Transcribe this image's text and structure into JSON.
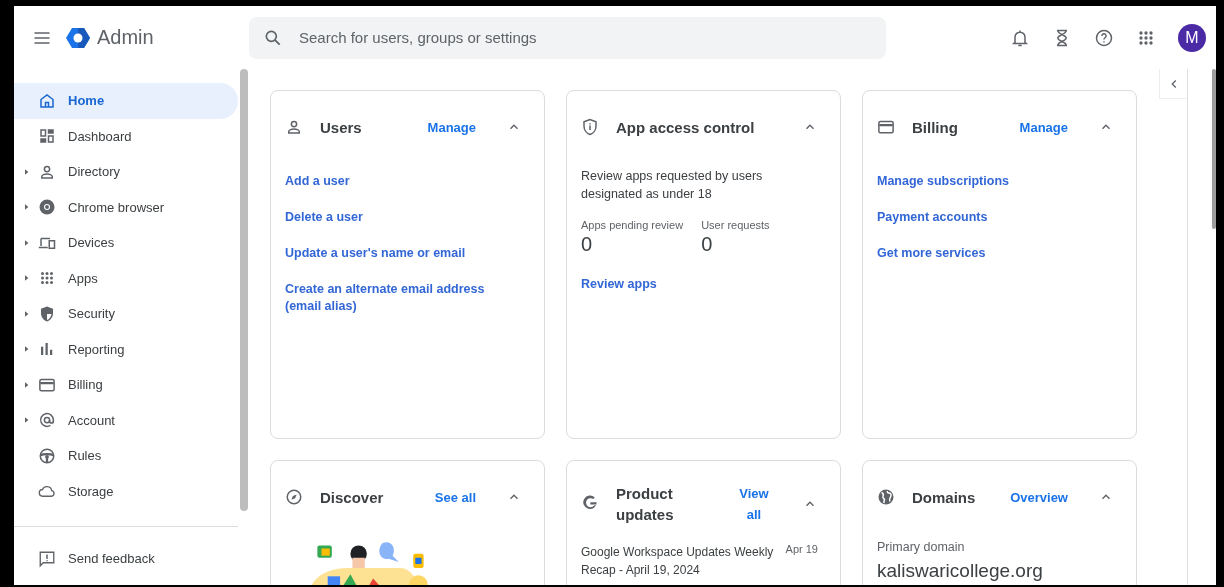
{
  "header": {
    "product": "Admin",
    "search": {
      "placeholder": "Search for users, groups or settings"
    },
    "avatar": "M"
  },
  "sidebar": {
    "items": [
      {
        "label": "Home",
        "kind": "plain",
        "selected": true
      },
      {
        "label": "Dashboard",
        "kind": "plain",
        "selected": false
      },
      {
        "label": "Directory",
        "kind": "expandable",
        "selected": false
      },
      {
        "label": "Chrome browser",
        "kind": "expandable",
        "selected": false
      },
      {
        "label": "Devices",
        "kind": "expandable",
        "selected": false
      },
      {
        "label": "Apps",
        "kind": "expandable",
        "selected": false
      },
      {
        "label": "Security",
        "kind": "expandable",
        "selected": false
      },
      {
        "label": "Reporting",
        "kind": "expandable",
        "selected": false
      },
      {
        "label": "Billing",
        "kind": "expandable",
        "selected": false
      },
      {
        "label": "Account",
        "kind": "expandable",
        "selected": false
      },
      {
        "label": "Rules",
        "kind": "plain",
        "selected": false
      },
      {
        "label": "Storage",
        "kind": "plain",
        "selected": false
      }
    ],
    "footer": "Send feedback"
  },
  "cards": [
    {
      "kind": "links",
      "title": "Users",
      "action": "Manage",
      "expanded": true,
      "links": [
        "Add a user",
        "Delete a user",
        "Update a user's name or email",
        "Create an alternate email address (email alias)"
      ]
    },
    {
      "kind": "access",
      "title": "App access control",
      "expanded": true,
      "description": "Review apps requested by users designated as under 18",
      "stats": [
        {
          "label": "Apps pending review",
          "value": "0"
        },
        {
          "label": "User requests",
          "value": "0"
        }
      ],
      "link": "Review apps"
    },
    {
      "kind": "links",
      "title": "Billing",
      "action": "Manage",
      "expanded": true,
      "links": [
        "Manage subscriptions",
        "Payment accounts",
        "Get more services"
      ]
    },
    {
      "kind": "discover",
      "title": "Discover",
      "action": "See all",
      "expanded": true
    },
    {
      "kind": "updates",
      "title": "Product updates",
      "action": "View all",
      "expanded": true,
      "items": [
        {
          "text": "Google Workspace Updates Weekly Recap - April 19, 2024",
          "date": "Apr 19"
        }
      ]
    },
    {
      "kind": "domain",
      "title": "Domains",
      "action": "Overview",
      "expanded": true,
      "label": "Primary domain",
      "value": "kaliswaricollege.org"
    }
  ]
}
